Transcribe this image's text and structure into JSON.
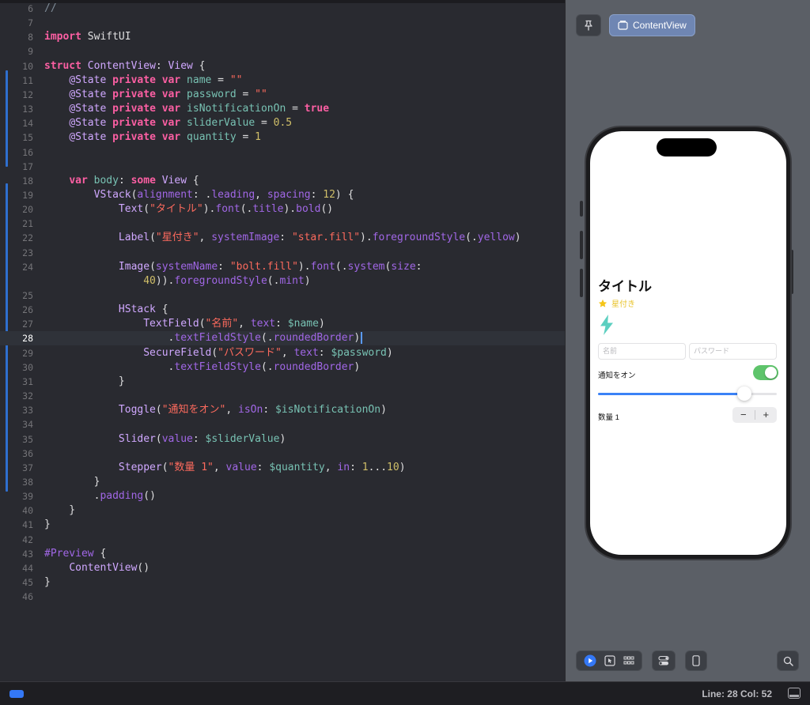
{
  "editor": {
    "current_line": 28,
    "lines": [
      {
        "n": "6",
        "tokens": [
          [
            "c-comment",
            "//"
          ]
        ]
      },
      {
        "n": "7",
        "tokens": []
      },
      {
        "n": "8",
        "tokens": [
          [
            "c-kw",
            "import"
          ],
          [
            "c-plain",
            " SwiftUI"
          ]
        ]
      },
      {
        "n": "9",
        "tokens": []
      },
      {
        "n": "10",
        "tokens": [
          [
            "c-kw",
            "struct"
          ],
          [
            "c-plain",
            " "
          ],
          [
            "c-type",
            "ContentView"
          ],
          [
            "c-plain",
            ": "
          ],
          [
            "c-type",
            "View"
          ],
          [
            "c-plain",
            " {"
          ]
        ]
      },
      {
        "n": "11",
        "tokens": [
          [
            "c-plain",
            "    "
          ],
          [
            "c-type",
            "@State"
          ],
          [
            "c-plain",
            " "
          ],
          [
            "c-kw",
            "private"
          ],
          [
            "c-plain",
            " "
          ],
          [
            "c-kw",
            "var"
          ],
          [
            "c-plain",
            " "
          ],
          [
            "c-var",
            "name"
          ],
          [
            "c-plain",
            " = "
          ],
          [
            "c-str",
            "\"\""
          ]
        ]
      },
      {
        "n": "12",
        "tokens": [
          [
            "c-plain",
            "    "
          ],
          [
            "c-type",
            "@State"
          ],
          [
            "c-plain",
            " "
          ],
          [
            "c-kw",
            "private"
          ],
          [
            "c-plain",
            " "
          ],
          [
            "c-kw",
            "var"
          ],
          [
            "c-plain",
            " "
          ],
          [
            "c-var",
            "password"
          ],
          [
            "c-plain",
            " = "
          ],
          [
            "c-str",
            "\"\""
          ]
        ]
      },
      {
        "n": "13",
        "tokens": [
          [
            "c-plain",
            "    "
          ],
          [
            "c-type",
            "@State"
          ],
          [
            "c-plain",
            " "
          ],
          [
            "c-kw",
            "private"
          ],
          [
            "c-plain",
            " "
          ],
          [
            "c-kw",
            "var"
          ],
          [
            "c-plain",
            " "
          ],
          [
            "c-var",
            "isNotificationOn"
          ],
          [
            "c-plain",
            " = "
          ],
          [
            "c-kw",
            "true"
          ]
        ]
      },
      {
        "n": "14",
        "tokens": [
          [
            "c-plain",
            "    "
          ],
          [
            "c-type",
            "@State"
          ],
          [
            "c-plain",
            " "
          ],
          [
            "c-kw",
            "private"
          ],
          [
            "c-plain",
            " "
          ],
          [
            "c-kw",
            "var"
          ],
          [
            "c-plain",
            " "
          ],
          [
            "c-var",
            "sliderValue"
          ],
          [
            "c-plain",
            " = "
          ],
          [
            "c-num",
            "0.5"
          ]
        ]
      },
      {
        "n": "15",
        "tokens": [
          [
            "c-plain",
            "    "
          ],
          [
            "c-type",
            "@State"
          ],
          [
            "c-plain",
            " "
          ],
          [
            "c-kw",
            "private"
          ],
          [
            "c-plain",
            " "
          ],
          [
            "c-kw",
            "var"
          ],
          [
            "c-plain",
            " "
          ],
          [
            "c-var",
            "quantity"
          ],
          [
            "c-plain",
            " = "
          ],
          [
            "c-num",
            "1"
          ]
        ]
      },
      {
        "n": "16",
        "tokens": []
      },
      {
        "n": "17",
        "tokens": []
      },
      {
        "n": "18",
        "tokens": [
          [
            "c-plain",
            "    "
          ],
          [
            "c-kw",
            "var"
          ],
          [
            "c-plain",
            " "
          ],
          [
            "c-var",
            "body"
          ],
          [
            "c-plain",
            ": "
          ],
          [
            "c-kw",
            "some"
          ],
          [
            "c-plain",
            " "
          ],
          [
            "c-type",
            "View"
          ],
          [
            "c-plain",
            " {"
          ]
        ]
      },
      {
        "n": "19",
        "tokens": [
          [
            "c-plain",
            "        "
          ],
          [
            "c-type",
            "VStack"
          ],
          [
            "c-plain",
            "("
          ],
          [
            "c-fn",
            "alignment"
          ],
          [
            "c-plain",
            ": ."
          ],
          [
            "c-fn",
            "leading"
          ],
          [
            "c-plain",
            ", "
          ],
          [
            "c-fn",
            "spacing"
          ],
          [
            "c-plain",
            ": "
          ],
          [
            "c-num",
            "12"
          ],
          [
            "c-plain",
            ") {"
          ]
        ]
      },
      {
        "n": "20",
        "tokens": [
          [
            "c-plain",
            "            "
          ],
          [
            "c-type",
            "Text"
          ],
          [
            "c-plain",
            "("
          ],
          [
            "c-str",
            "\"タイトル\""
          ],
          [
            "c-plain",
            ")."
          ],
          [
            "c-fn",
            "font"
          ],
          [
            "c-plain",
            "(."
          ],
          [
            "c-fn",
            "title"
          ],
          [
            "c-plain",
            ")."
          ],
          [
            "c-fn",
            "bold"
          ],
          [
            "c-plain",
            "()"
          ]
        ]
      },
      {
        "n": "21",
        "tokens": []
      },
      {
        "n": "22",
        "tokens": [
          [
            "c-plain",
            "            "
          ],
          [
            "c-type",
            "Label"
          ],
          [
            "c-plain",
            "("
          ],
          [
            "c-str",
            "\"星付き\""
          ],
          [
            "c-plain",
            ", "
          ],
          [
            "c-fn",
            "systemImage"
          ],
          [
            "c-plain",
            ": "
          ],
          [
            "c-str",
            "\"star.fill\""
          ],
          [
            "c-plain",
            ")."
          ],
          [
            "c-fn",
            "foregroundStyle"
          ],
          [
            "c-plain",
            "(."
          ],
          [
            "c-fn",
            "yellow"
          ],
          [
            "c-plain",
            ")"
          ]
        ]
      },
      {
        "n": "23",
        "tokens": []
      },
      {
        "n": "24",
        "tokens": [
          [
            "c-plain",
            "            "
          ],
          [
            "c-type",
            "Image"
          ],
          [
            "c-plain",
            "("
          ],
          [
            "c-fn",
            "systemName"
          ],
          [
            "c-plain",
            ": "
          ],
          [
            "c-str",
            "\"bolt.fill\""
          ],
          [
            "c-plain",
            ")."
          ],
          [
            "c-fn",
            "font"
          ],
          [
            "c-plain",
            "(."
          ],
          [
            "c-fn",
            "system"
          ],
          [
            "c-plain",
            "("
          ],
          [
            "c-fn",
            "size"
          ],
          [
            "c-plain",
            ":"
          ]
        ]
      },
      {
        "n": "",
        "tokens": [
          [
            "c-plain",
            "                "
          ],
          [
            "c-num",
            "40"
          ],
          [
            "c-plain",
            "))."
          ],
          [
            "c-fn",
            "foregroundStyle"
          ],
          [
            "c-plain",
            "(."
          ],
          [
            "c-fn",
            "mint"
          ],
          [
            "c-plain",
            ")"
          ]
        ]
      },
      {
        "n": "25",
        "tokens": []
      },
      {
        "n": "26",
        "tokens": [
          [
            "c-plain",
            "            "
          ],
          [
            "c-type",
            "HStack"
          ],
          [
            "c-plain",
            " {"
          ]
        ]
      },
      {
        "n": "27",
        "tokens": [
          [
            "c-plain",
            "                "
          ],
          [
            "c-type",
            "TextField"
          ],
          [
            "c-plain",
            "("
          ],
          [
            "c-str",
            "\"名前\""
          ],
          [
            "c-plain",
            ", "
          ],
          [
            "c-fn",
            "text"
          ],
          [
            "c-plain",
            ": "
          ],
          [
            "c-var",
            "$name"
          ],
          [
            "c-plain",
            ")"
          ]
        ]
      },
      {
        "n": "28",
        "tokens": [
          [
            "c-plain",
            "                    ."
          ],
          [
            "c-fn",
            "textFieldStyle"
          ],
          [
            "c-plain",
            "(."
          ],
          [
            "c-fn",
            "roundedBorder"
          ],
          [
            "c-plain",
            ")"
          ]
        ],
        "caret": true
      },
      {
        "n": "29",
        "tokens": [
          [
            "c-plain",
            "                "
          ],
          [
            "c-type",
            "SecureField"
          ],
          [
            "c-plain",
            "("
          ],
          [
            "c-str",
            "\"パスワード\""
          ],
          [
            "c-plain",
            ", "
          ],
          [
            "c-fn",
            "text"
          ],
          [
            "c-plain",
            ": "
          ],
          [
            "c-var",
            "$password"
          ],
          [
            "c-plain",
            ")"
          ]
        ]
      },
      {
        "n": "30",
        "tokens": [
          [
            "c-plain",
            "                    ."
          ],
          [
            "c-fn",
            "textFieldStyle"
          ],
          [
            "c-plain",
            "(."
          ],
          [
            "c-fn",
            "roundedBorder"
          ],
          [
            "c-plain",
            ")"
          ]
        ]
      },
      {
        "n": "31",
        "tokens": [
          [
            "c-plain",
            "            }"
          ]
        ]
      },
      {
        "n": "32",
        "tokens": []
      },
      {
        "n": "33",
        "tokens": [
          [
            "c-plain",
            "            "
          ],
          [
            "c-type",
            "Toggle"
          ],
          [
            "c-plain",
            "("
          ],
          [
            "c-str",
            "\"通知をオン\""
          ],
          [
            "c-plain",
            ", "
          ],
          [
            "c-fn",
            "isOn"
          ],
          [
            "c-plain",
            ": "
          ],
          [
            "c-var",
            "$isNotificationOn"
          ],
          [
            "c-plain",
            ")"
          ]
        ]
      },
      {
        "n": "34",
        "tokens": []
      },
      {
        "n": "35",
        "tokens": [
          [
            "c-plain",
            "            "
          ],
          [
            "c-type",
            "Slider"
          ],
          [
            "c-plain",
            "("
          ],
          [
            "c-fn",
            "value"
          ],
          [
            "c-plain",
            ": "
          ],
          [
            "c-var",
            "$sliderValue"
          ],
          [
            "c-plain",
            ")"
          ]
        ]
      },
      {
        "n": "36",
        "tokens": []
      },
      {
        "n": "37",
        "tokens": [
          [
            "c-plain",
            "            "
          ],
          [
            "c-type",
            "Stepper"
          ],
          [
            "c-plain",
            "("
          ],
          [
            "c-str",
            "\"数量 1\""
          ],
          [
            "c-plain",
            ", "
          ],
          [
            "c-fn",
            "value"
          ],
          [
            "c-plain",
            ": "
          ],
          [
            "c-var",
            "$quantity"
          ],
          [
            "c-plain",
            ", "
          ],
          [
            "c-fn",
            "in"
          ],
          [
            "c-plain",
            ": "
          ],
          [
            "c-num",
            "1"
          ],
          [
            "c-plain",
            "..."
          ],
          [
            "c-num",
            "10"
          ],
          [
            "c-plain",
            ")"
          ]
        ]
      },
      {
        "n": "38",
        "tokens": [
          [
            "c-plain",
            "        }"
          ]
        ]
      },
      {
        "n": "39",
        "tokens": [
          [
            "c-plain",
            "        ."
          ],
          [
            "c-fn",
            "padding"
          ],
          [
            "c-plain",
            "()"
          ]
        ]
      },
      {
        "n": "40",
        "tokens": [
          [
            "c-plain",
            "    }"
          ]
        ]
      },
      {
        "n": "41",
        "tokens": [
          [
            "c-plain",
            "}"
          ]
        ]
      },
      {
        "n": "42",
        "tokens": []
      },
      {
        "n": "43",
        "tokens": [
          [
            "c-fn",
            "#Preview"
          ],
          [
            "c-plain",
            " {"
          ]
        ]
      },
      {
        "n": "44",
        "tokens": [
          [
            "c-plain",
            "    "
          ],
          [
            "c-type",
            "ContentView"
          ],
          [
            "c-plain",
            "()"
          ]
        ]
      },
      {
        "n": "45",
        "tokens": [
          [
            "c-plain",
            "}"
          ]
        ]
      },
      {
        "n": "46",
        "tokens": []
      }
    ]
  },
  "preview": {
    "pin_icon": "pin-icon",
    "view_button_label": "ContentView",
    "device": {
      "title": "タイトル",
      "star_label": "星付き",
      "name_placeholder": "名前",
      "password_placeholder": "パスワード",
      "toggle_label": "通知をオン",
      "toggle_on": true,
      "slider_value": 0.82,
      "stepper_label": "数量 1",
      "stepper_minus": "−",
      "stepper_plus": "+"
    },
    "toolbar_icons": [
      "play-icon",
      "select-icon",
      "grid-icon",
      "variants-icon",
      "device-icon",
      "zoom-icon"
    ]
  },
  "status_bar": {
    "cursor_position": "Line: 28  Col: 52"
  },
  "colors": {
    "editor_bg": "#292a30",
    "keyword": "#fc5fa3",
    "string": "#fc6a5d",
    "number": "#d0bf69",
    "type": "#d0a8ff",
    "accent": "#3478f6",
    "toggle_on": "#5ec46b",
    "star": "#f5c518",
    "bolt": "#5ccfc0"
  }
}
